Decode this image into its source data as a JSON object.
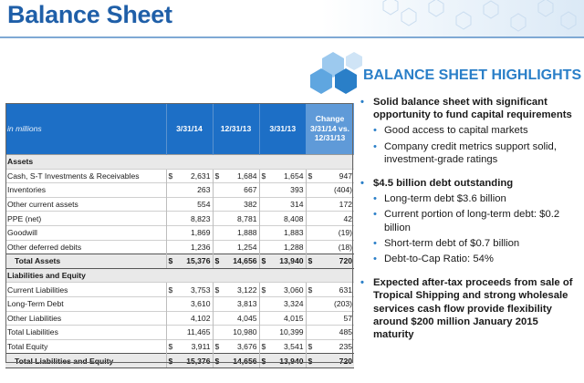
{
  "title": "Balance Sheet",
  "highlights_title": "BALANCE SHEET HIGHLIGHTS",
  "table": {
    "units": "in millions",
    "col_dates": [
      "3/31/14",
      "12/31/13",
      "3/31/13"
    ],
    "change_header": "Change 3/31/14 vs. 12/31/13",
    "assets_section": "Assets",
    "assets": [
      {
        "label": "Cash, S-T Investments & Receivables",
        "sym": true,
        "v": [
          "2,631",
          "1,684",
          "1,654"
        ],
        "chg": "947"
      },
      {
        "label": "Inventories",
        "sym": false,
        "v": [
          "263",
          "667",
          "393"
        ],
        "chg": "(404)"
      },
      {
        "label": "Other current assets",
        "sym": false,
        "v": [
          "554",
          "382",
          "314"
        ],
        "chg": "172"
      },
      {
        "label": "PPE (net)",
        "sym": false,
        "v": [
          "8,823",
          "8,781",
          "8,408"
        ],
        "chg": "42"
      },
      {
        "label": "Goodwill",
        "sym": false,
        "v": [
          "1,869",
          "1,888",
          "1,883"
        ],
        "chg": "(19)"
      },
      {
        "label": "Other deferred debits",
        "sym": false,
        "v": [
          "1,236",
          "1,254",
          "1,288"
        ],
        "chg": "(18)"
      }
    ],
    "total_assets": {
      "label": "Total Assets",
      "v": [
        "15,376",
        "14,656",
        "13,940"
      ],
      "chg": "720"
    },
    "liab_section": "Liabilities and Equity",
    "liabilities": [
      {
        "label": "Current Liabilities",
        "sym": true,
        "v": [
          "3,753",
          "3,122",
          "3,060"
        ],
        "chg": "631"
      },
      {
        "label": "Long-Term Debt",
        "sym": false,
        "v": [
          "3,610",
          "3,813",
          "3,324"
        ],
        "chg": "(203)"
      },
      {
        "label": "Other Liabilities",
        "sym": false,
        "v": [
          "4,102",
          "4,045",
          "4,015"
        ],
        "chg": "57"
      },
      {
        "label": "Total Liabilities",
        "sym": false,
        "v": [
          "11,465",
          "10,980",
          "10,399"
        ],
        "chg": "485"
      },
      {
        "label": "Total Equity",
        "sym": true,
        "v": [
          "3,911",
          "3,676",
          "3,541"
        ],
        "chg": "235"
      }
    ],
    "total_le": {
      "label": "Total Liabilities and Equity",
      "v": [
        "15,376",
        "14,656",
        "13,940"
      ],
      "chg": "720"
    },
    "currency_symbol": "$"
  },
  "highlights": {
    "h1": "Solid balance sheet with significant opportunity to fund capital requirements",
    "h1_sub": [
      "Good access to capital markets",
      "Company credit metrics support solid, investment-grade ratings"
    ],
    "h2": "$4.5 billion debt outstanding",
    "h2_sub": [
      "Long-term debt $3.6 billion",
      "Current portion of long-term debt: $0.2 billion",
      "Short-term debt of $0.7 billion",
      "Debt-to-Cap Ratio: 54%"
    ],
    "h3": "Expected after-tax proceeds from sale of Tropical Shipping and strong wholesale services cash flow provide flexibility around $200 million January 2015 maturity"
  }
}
